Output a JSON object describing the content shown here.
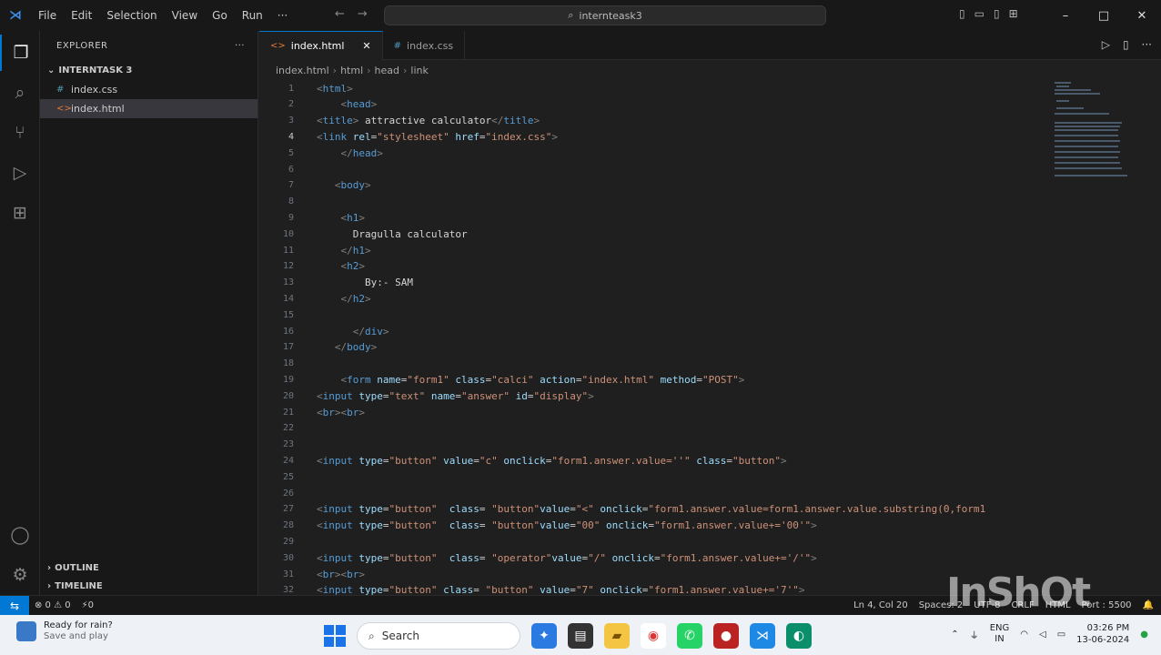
{
  "titlebar": {
    "menu": [
      "File",
      "Edit",
      "Selection",
      "View",
      "Go",
      "Run",
      "···"
    ],
    "search_text": "internteask3"
  },
  "sidebar": {
    "title": "EXPLORER",
    "folder": "INTERNTASK 3",
    "files": [
      {
        "name": "index.css",
        "icon": "#",
        "type": "css"
      },
      {
        "name": "index.html",
        "icon": "<>",
        "type": "html"
      }
    ],
    "outline": "OUTLINE",
    "timeline": "TIMELINE"
  },
  "tabs": [
    {
      "label": "index.html",
      "icon": "<>"
    },
    {
      "label": "index.css",
      "icon": "#"
    }
  ],
  "breadcrumb": [
    "index.html",
    "html",
    "head",
    "link"
  ],
  "editor": {
    "line_numbers": [
      "1",
      "2",
      "3",
      "4",
      "5",
      "6",
      "7",
      "8",
      "9",
      "10",
      "11",
      "12",
      "13",
      "14",
      "15",
      "16",
      "17",
      "18",
      "19",
      "20",
      "21",
      "22",
      "23",
      "24",
      "25",
      "26",
      "27",
      "28",
      "29",
      "30",
      "31",
      "32"
    ]
  },
  "statusbar": {
    "problems": "⊗ 0 ⚠ 0",
    "ports": "⚡0",
    "position": "Ln 4, Col 20",
    "spaces": "Spaces: 2",
    "encoding": "UTF-8",
    "eol": "CRLF",
    "language": "HTML",
    "port": "Port : 5500"
  },
  "taskbar": {
    "weather_title": "Ready for rain?",
    "weather_sub": "Save and play",
    "search_label": "Search",
    "lang_top": "ENG",
    "lang_bottom": "IN",
    "time": "03:26 PM",
    "date": "13-06-2024"
  },
  "watermark": "InShOt",
  "colors": {
    "accent": "#0078d4",
    "editor_bg": "#1f1f1f",
    "tag_name": "#569cd6",
    "attr_name": "#9cdcfe",
    "attr_value": "#ce9178"
  }
}
